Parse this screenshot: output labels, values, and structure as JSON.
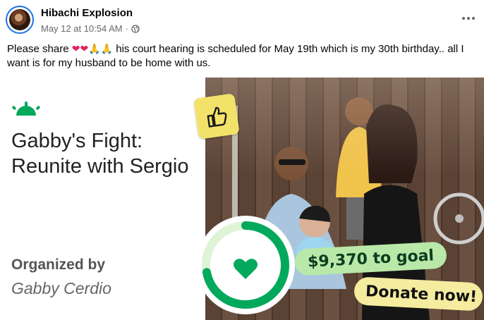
{
  "post": {
    "page_name": "Hibachi Explosion",
    "timestamp": "May 12 at 10:54 AM",
    "separator": "·",
    "audience_icon": "globe-icon",
    "more_icon": "more-options-icon",
    "text": "his court hearing is scheduled for May 19th which is my 30th birthday.. all I want is for my husband to be home with us.",
    "text_prefix": "Please share",
    "emojis": [
      "❤",
      "❤",
      "🙏",
      "🙏"
    ]
  },
  "fundraiser": {
    "title": "Gabby's Fight: Reunite with Sergio",
    "organized_by_label": "Organized by",
    "organizer_name": "Gabby Cerdio",
    "goal_text": "$9,370 to goal",
    "donate_label": "Donate now!",
    "progress_fraction": 0.72,
    "colors": {
      "brand_green": "#02a95c",
      "ring_light": "#b9e8a8",
      "goal_pill": "#b9e8a8",
      "donate_pill": "#f5eca0",
      "thumb_badge": "#f2e26a"
    },
    "icons": [
      "gofundme-logo-icon",
      "thumbs-up-icon",
      "heart-icon"
    ]
  }
}
